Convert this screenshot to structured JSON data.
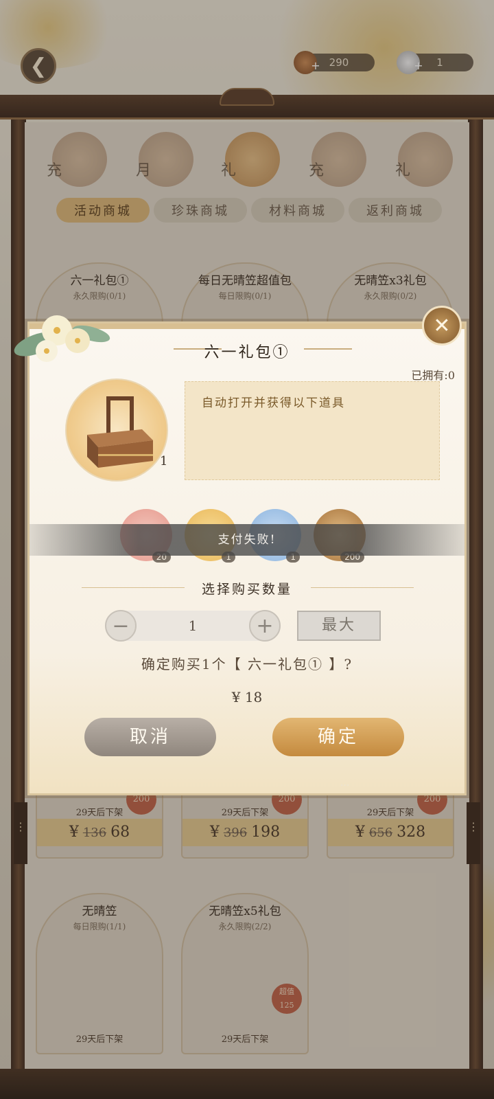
{
  "header": {
    "back_icon": "back-arrow-icon",
    "currency_a": {
      "icon": "coin-pouch-icon",
      "value": "290"
    },
    "currency_b": {
      "icon": "pearl-icon",
      "value": "1"
    }
  },
  "categories": [
    {
      "label": "充",
      "icon": "coin-icon"
    },
    {
      "label": "月",
      "icon": "card-icon"
    },
    {
      "label": "礼",
      "icon": "gift-box-icon"
    },
    {
      "label": "充",
      "icon": "present-icon"
    },
    {
      "label": "礼",
      "icon": "scroll-icon"
    }
  ],
  "subtabs": [
    "活动商城",
    "珍珠商城",
    "材料商城",
    "返利商城"
  ],
  "cards_row1": [
    {
      "title": "六一礼包①",
      "limit": "永久限购(0/1)",
      "badge": "200",
      "offshelf": "29天后下架",
      "old_price": "136",
      "new_price": "68"
    },
    {
      "title": "每日无晴笠超值包",
      "limit": "每日限购(0/1)",
      "badge": "200",
      "offshelf": "29天后下架",
      "old_price": "396",
      "new_price": "198"
    },
    {
      "title": "无晴笠x3礼包",
      "limit": "永久限购(0/2)",
      "badge": "200",
      "offshelf": "29天后下架",
      "old_price": "656",
      "new_price": "328"
    }
  ],
  "cards_row2": [
    {
      "title": "无晴笠",
      "limit": "每日限购(1/1)",
      "offshelf": "29天后下架"
    },
    {
      "title": "无晴笠x5礼包",
      "limit": "永久限购(2/2)",
      "badge": "超值 125",
      "offshelf": "29天后下架"
    }
  ],
  "currency_symbol": "¥",
  "modal": {
    "title": "六一礼包①",
    "owned": "已拥有:0",
    "pack_count": "1",
    "description": "自动打开并获得以下道具",
    "rewards": [
      {
        "icon": "pink-token-icon",
        "count": "20",
        "color": "#eab1a6"
      },
      {
        "icon": "gold-token-icon",
        "count": "1",
        "color": "#f0c96e"
      },
      {
        "icon": "blue-token-icon",
        "count": "1",
        "color": "#9cc1e6"
      },
      {
        "icon": "bronze-coin-icon",
        "count": "200",
        "color": "#c8995a"
      }
    ],
    "toast": "支付失败!",
    "qty_title": "选择购买数量",
    "qty_value": "1",
    "max_label": "最大",
    "confirm_question": "确定购买1个【 六一礼包① 】?",
    "price": "¥ 18",
    "cancel_label": "取消",
    "ok_label": "确定",
    "close_icon": "close-icon"
  },
  "colors": {
    "accent_gold": "#c48a3e",
    "cancel_gray": "#8f867d"
  }
}
